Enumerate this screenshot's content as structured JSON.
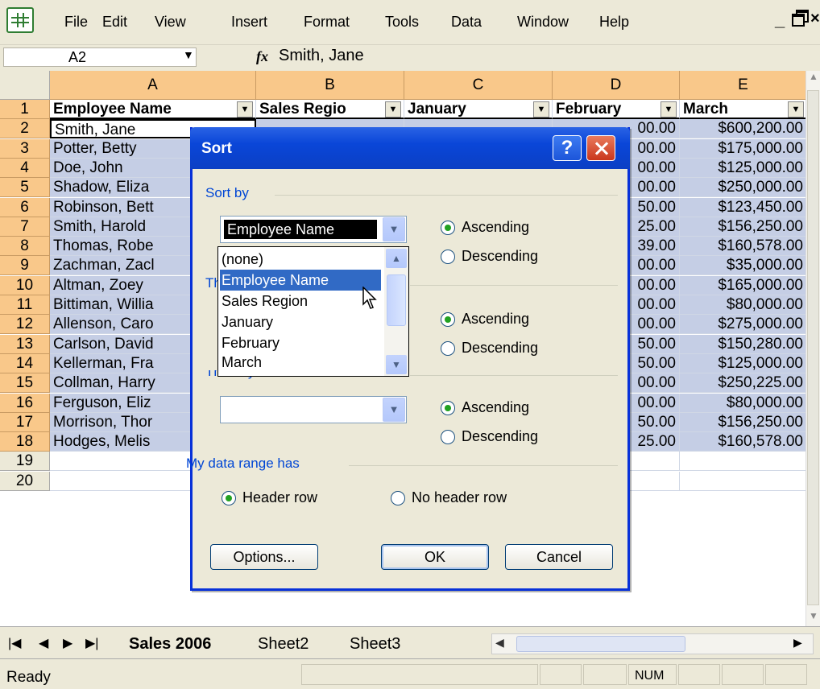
{
  "menu": {
    "items": [
      {
        "label": "File",
        "key": "F"
      },
      {
        "label": "Edit",
        "key": "E"
      },
      {
        "label": "View",
        "key": "V"
      },
      {
        "label": "Insert",
        "key": "I"
      },
      {
        "label": "Format",
        "key": "o"
      },
      {
        "label": "Tools",
        "key": "T"
      },
      {
        "label": "Data",
        "key": "D"
      },
      {
        "label": "Window",
        "key": "W"
      },
      {
        "label": "Help",
        "key": "H"
      }
    ]
  },
  "formula_bar": {
    "name_box": "A2",
    "fx_label": "fx",
    "formula": "Smith, Jane"
  },
  "columns": [
    "A",
    "B",
    "C",
    "D",
    "E"
  ],
  "rows": [
    "1",
    "2",
    "3",
    "4",
    "5",
    "6",
    "7",
    "8",
    "9",
    "10",
    "11",
    "12",
    "13",
    "14",
    "15",
    "16",
    "17",
    "18",
    "19",
    "20"
  ],
  "header_row": [
    "Employee Name",
    "Sales Regio",
    "January",
    "February",
    "March"
  ],
  "col_a": [
    "Smith, Jane",
    "Potter, Betty",
    "Doe, John",
    "Shadow, Eliza",
    "Robinson, Bett",
    "Smith, Harold",
    "Thomas, Robe",
    "Zachman, Zacl",
    "Altman, Zoey",
    "Bittiman, Willia",
    "Allenson, Caro",
    "Carlson, David",
    "Kellerman, Fra",
    "Collman, Harry",
    "Ferguson, Eliz",
    "Morrison, Thor",
    "Hodges, Melis"
  ],
  "col_d": [
    "00.00",
    "00.00",
    "00.00",
    "00.00",
    "50.00",
    "25.00",
    "39.00",
    "00.00",
    "00.00",
    "00.00",
    "00.00",
    "50.00",
    "50.00",
    "00.00",
    "00.00",
    "50.00",
    "25.00"
  ],
  "col_e": [
    "$600,200.00",
    "$175,000.00",
    "$125,000.00",
    "$250,000.00",
    "$123,450.00",
    "$156,250.00",
    "$160,578.00",
    "$35,000.00",
    "$165,000.00",
    "$80,000.00",
    "$275,000.00",
    "$150,280.00",
    "$125,000.00",
    "$250,225.00",
    "$80,000.00",
    "$156,250.00",
    "$160,578.00"
  ],
  "sheet_tabs": [
    "Sales 2006",
    "Sheet2",
    "Sheet3"
  ],
  "status": {
    "text": "Ready",
    "num": "NUM"
  },
  "dialog": {
    "title": "Sort",
    "help": "?",
    "sort_by_label": "Sort by",
    "sort_by_value": "Employee Name",
    "then_by_label_partial": "Th",
    "then_by2_label": "Then by",
    "ascending": "Ascending",
    "descending": "Descending",
    "data_range_label": "My data range has",
    "header_row": "Header row",
    "no_header_row": "No header row",
    "options": "Options...",
    "ok": "OK",
    "cancel": "Cancel",
    "dropdown_options": [
      "(none)",
      "Employee Name",
      "Sales Region",
      "January",
      "February",
      "March"
    ]
  },
  "colors": {
    "header_orange": "#f9c88a",
    "selection_blue": "#c5cee5",
    "dialog_title_blue": "#0a46d8",
    "group_label_blue": "#0046d5"
  }
}
